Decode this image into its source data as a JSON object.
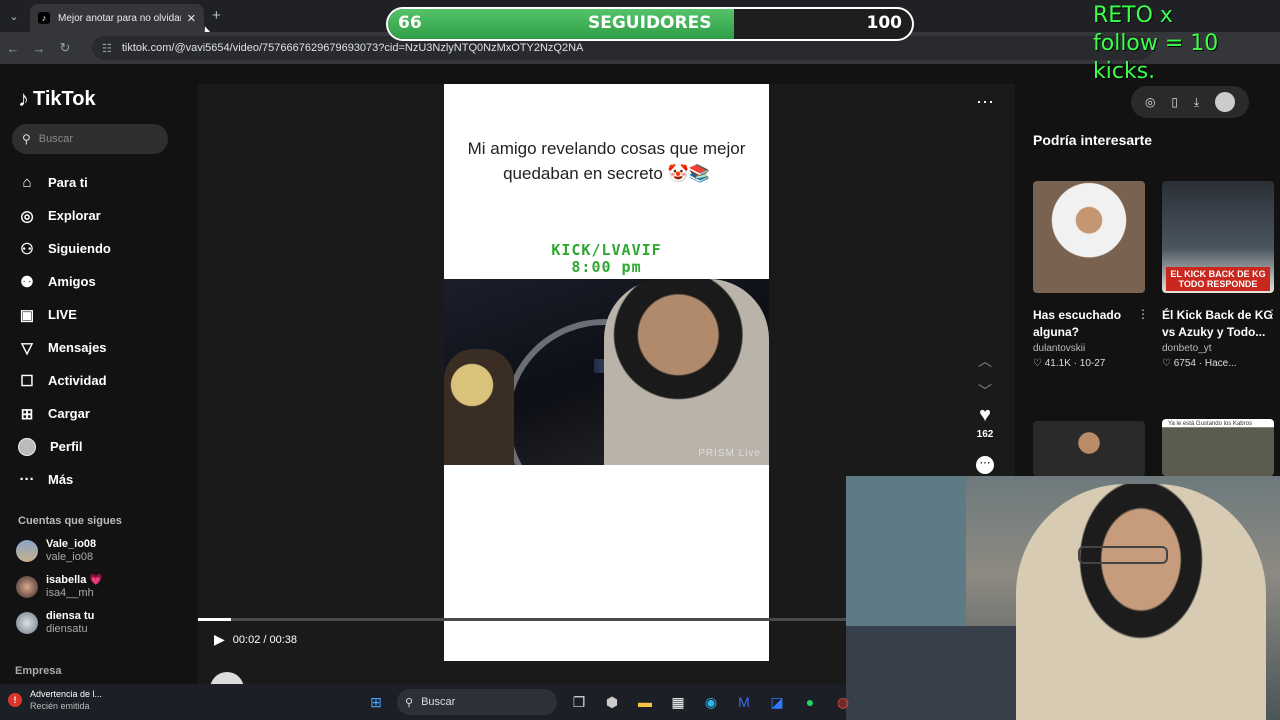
{
  "browser": {
    "tab_title": "Mejor anotar para no olvidar x",
    "tab_favicon": "tiktok-favicon",
    "url": "tiktok.com/@vavi5654/video/7576667629679693073?cid=NzU3NzlyNTQ0NzMxOTY2NzQ2NA"
  },
  "overlay": {
    "current_followers": "66",
    "label": "SEGUIDORES",
    "goal": "100",
    "progress_fraction": 0.66,
    "reto_line1": "RETO  x",
    "reto_line2": "follow = 10 kicks.",
    "bar_color": "#3fb358",
    "reto_color": "#39ff4a"
  },
  "sidebar": {
    "logo": "TikTok",
    "search_placeholder": "Buscar",
    "items": [
      {
        "label": "Para ti",
        "icon": "home-icon"
      },
      {
        "label": "Explorar",
        "icon": "compass-icon"
      },
      {
        "label": "Siguiendo",
        "icon": "following-icon"
      },
      {
        "label": "Amigos",
        "icon": "friends-icon"
      },
      {
        "label": "LIVE",
        "icon": "live-icon"
      },
      {
        "label": "Mensajes",
        "icon": "messages-icon"
      },
      {
        "label": "Actividad",
        "icon": "activity-icon"
      },
      {
        "label": "Cargar",
        "icon": "upload-icon"
      },
      {
        "label": "Perfil",
        "icon": "profile-avatar"
      },
      {
        "label": "Más",
        "icon": "more-icon"
      }
    ],
    "following_title": "Cuentas que sigues",
    "following": [
      {
        "name": "Vale_io08",
        "handle": "vale_io08"
      },
      {
        "name": "isabella 💗",
        "handle": "isa4__mh"
      },
      {
        "name": "diensa tu",
        "handle": "diensatu"
      }
    ],
    "company": "Empresa"
  },
  "video": {
    "caption": "Mi amigo revelando cosas que mejor quedaban en secreto 🤡📚",
    "kick_line1": "KICK/LVAVIF",
    "kick_line2": "8:00 pm",
    "watermark": "PRISM Live",
    "time": "00:02 / 00:38",
    "progress_fraction": 0.05,
    "author": "vavi5654",
    "likes": "162"
  },
  "suggestions": {
    "title": "Podría interesarte",
    "cards": [
      {
        "title": "Has escuchado alguna?",
        "channel": "dulantovskii",
        "meta": "♡ 41.1K · 10-27"
      },
      {
        "title": "Él Kick Back de KG vs Azuky y Todo...",
        "channel": "donbeto_yt",
        "meta": "♡ 6754 · Hace...",
        "banner": "EL KICK BACK DE KG TODO RESPONDE"
      },
      {
        "title": "",
        "channel": "",
        "meta": ""
      },
      {
        "title": "",
        "channel": "",
        "meta": "",
        "small": "Ya le está Gustando los Kabros"
      }
    ]
  },
  "taskbar": {
    "notification_title": "Advertencia de l...",
    "notification_sub": "Recién emitida",
    "search_placeholder": "Buscar"
  }
}
